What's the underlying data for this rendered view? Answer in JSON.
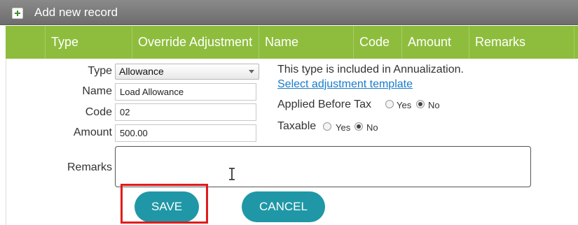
{
  "panel": {
    "title": "Add new record",
    "add_icon": "plus-icon"
  },
  "columns": [
    "Type",
    "Override Adjustment",
    "Name",
    "Code",
    "Amount",
    "Remarks"
  ],
  "form": {
    "type_label": "Type",
    "type_value": "Allowance",
    "name_label": "Name",
    "name_value": "Load Allowance",
    "code_label": "Code",
    "code_value": "02",
    "amount_label": "Amount",
    "amount_value": "500.00",
    "remarks_label": "Remarks",
    "remarks_value": ""
  },
  "info": {
    "annualization_text": "This type is included in Annualization.",
    "template_link": "Select adjustment template"
  },
  "applied_before_tax": {
    "label": "Applied Before Tax",
    "yes": "Yes",
    "no": "No",
    "selected": "No"
  },
  "taxable": {
    "label": "Taxable",
    "yes": "Yes",
    "no": "No",
    "selected": "No"
  },
  "buttons": {
    "save": "SAVE",
    "cancel": "CANCEL"
  },
  "colors": {
    "header_green": "#8ebd3d",
    "button_teal": "#1f97a6",
    "highlight_red": "#e01c1c",
    "link_blue": "#1a7bc9"
  }
}
